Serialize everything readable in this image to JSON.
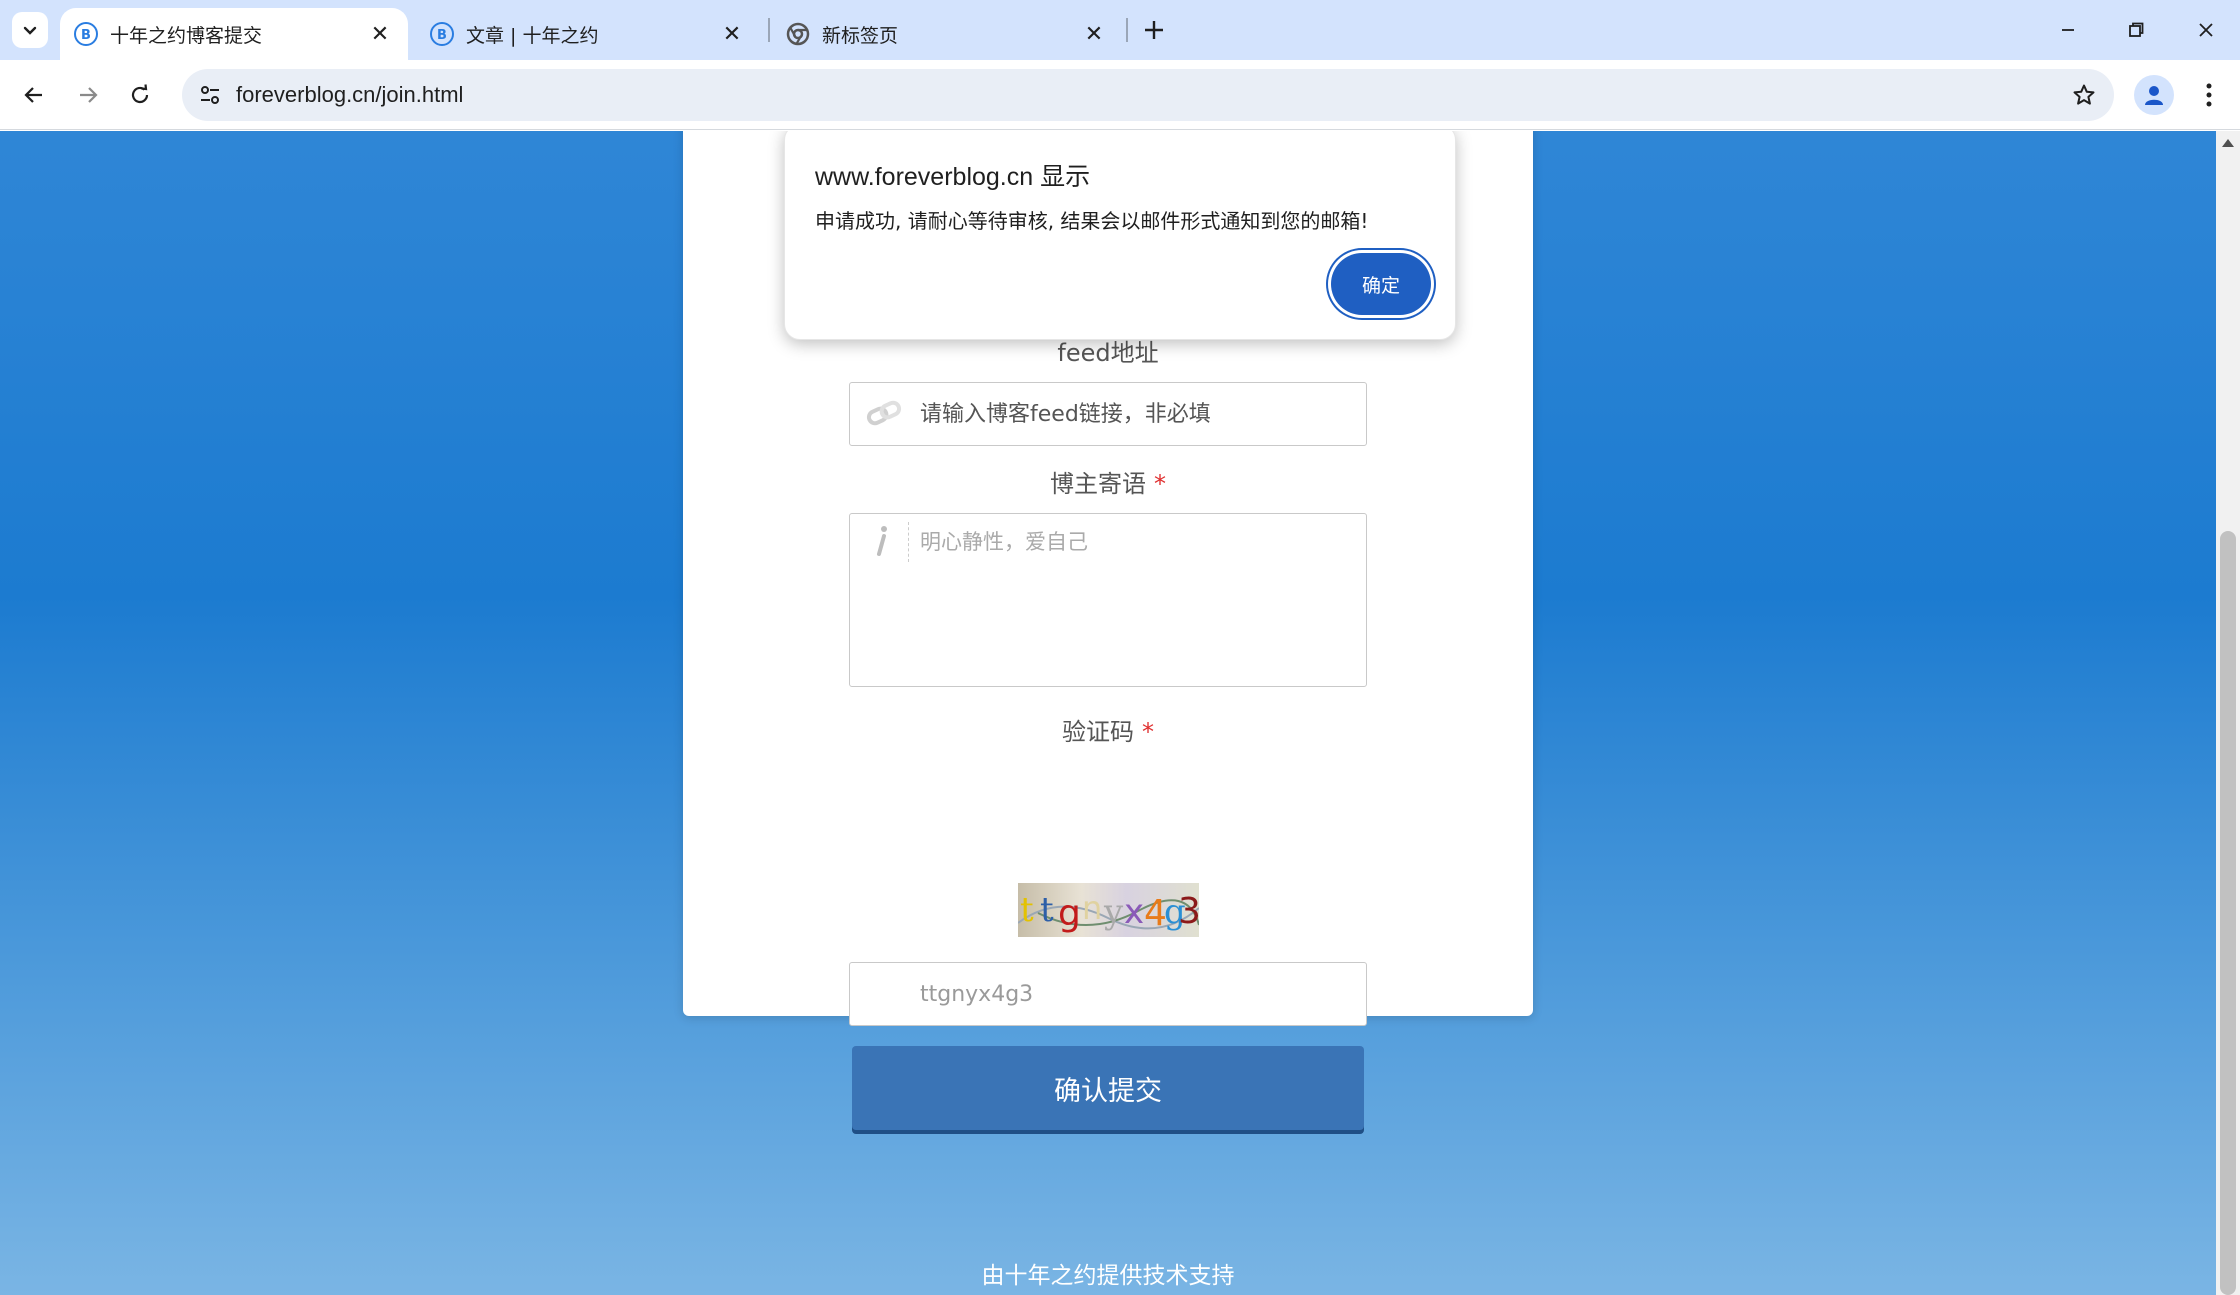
{
  "browser": {
    "tabs": [
      {
        "title": "十年之约博客提交",
        "active": true
      },
      {
        "title": "文章 | 十年之约",
        "active": false
      },
      {
        "title": "新标签页",
        "active": false
      }
    ],
    "url": "foreverblog.cn/join.html"
  },
  "form": {
    "feed": {
      "label": "feed地址",
      "placeholder": "请输入博客feed链接，非必填"
    },
    "message": {
      "label": "博主寄语",
      "required_mark": "*",
      "placeholder": "明心静性，爱自己"
    },
    "captcha": {
      "label": "验证码",
      "required_mark": "*",
      "image_text": "ttgnyx4g3",
      "value": "ttgnyx4g3"
    },
    "submit_label": "确认提交"
  },
  "footer": {
    "text": "由十年之约提供技术支持"
  },
  "alert": {
    "title": "www.foreverblog.cn 显示",
    "message": "申请成功, 请耐心等待审核, 结果会以邮件形式通知到您的邮箱!",
    "ok_label": "确定"
  },
  "colors": {
    "tabstrip": "#d3e3fd",
    "page_gradient_top": "#2f86d6",
    "page_gradient_bottom": "#7ab5e4",
    "submit_button": "#3a74b6",
    "dialog_ok": "#1f5fc2",
    "required": "#e03030"
  },
  "icons": {
    "feed_field": "link-icon",
    "message_field": "info-icon",
    "tab_favicon": "blog-favicon-icon",
    "newtab_favicon": "chrome-icon"
  }
}
